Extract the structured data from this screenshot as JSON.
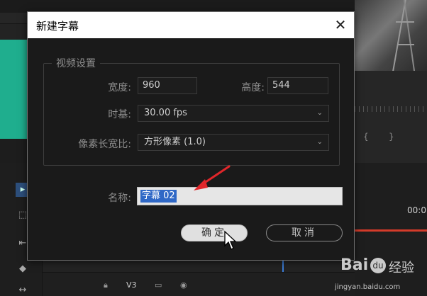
{
  "background": {
    "timecode": "00:0",
    "track_label": "V3",
    "watermark": {
      "logo": "Bai",
      "paw": "du",
      "site_name": "经验",
      "url": "jingyan.baidu.com"
    }
  },
  "dialog": {
    "title": "新建字幕",
    "close_label": "✕",
    "video_settings": {
      "group_title": "视频设置",
      "width_label": "宽度:",
      "width_value": "960",
      "height_label": "高度:",
      "height_value": "544",
      "timebase_label": "时基:",
      "timebase_value": "30.00 fps",
      "pixel_aspect_label": "像素长宽比:",
      "pixel_aspect_value": "方形像素 (1.0)"
    },
    "name_label": "名称:",
    "name_value": "字幕 02",
    "ok_label": "确定",
    "cancel_label": "取消"
  },
  "colors": {
    "accent_teal": "#1fae8e",
    "selection_blue": "#2f68c6",
    "annotation_red": "#e0262a",
    "timeline_red": "#d43b2a"
  }
}
